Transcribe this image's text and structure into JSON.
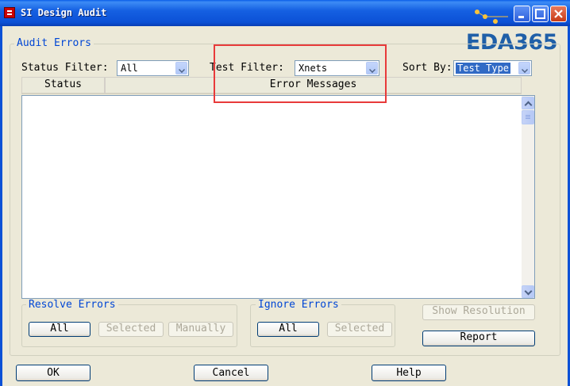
{
  "window": {
    "title": "SI Design Audit",
    "watermark": "EDA365"
  },
  "audit_errors": {
    "legend": "Audit Errors",
    "status_filter": {
      "label": "Status Filter:",
      "value": "All"
    },
    "test_filter": {
      "label": "Test Filter:",
      "value": "Xnets"
    },
    "sort_by": {
      "label": "Sort By:",
      "value": "Test Type"
    },
    "columns": [
      "Status",
      "Error Messages"
    ],
    "rows": []
  },
  "resolve_errors": {
    "legend": "Resolve Errors",
    "all": "All",
    "selected": "Selected",
    "manually": "Manually"
  },
  "ignore_errors": {
    "legend": "Ignore Errors",
    "all": "All",
    "selected": "Selected"
  },
  "actions": {
    "show_resolution": "Show Resolution",
    "report": "Report"
  },
  "footer": {
    "ok": "OK",
    "cancel": "Cancel",
    "help": "Help"
  },
  "colors": {
    "titlebar": "#0c51d6",
    "legend_text": "#0046d5",
    "annotation": "#e83a3a",
    "watermark": "#1f5fa8"
  }
}
